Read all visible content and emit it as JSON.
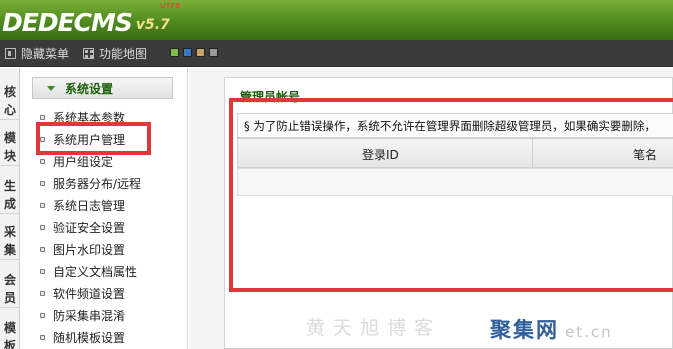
{
  "app": {
    "logo_text": "DEDECMS",
    "version": "v5.7",
    "version_badge": "UTF8"
  },
  "toolbar": {
    "hide_menu_label": "隐藏菜单",
    "function_map_label": "功能地图",
    "skin_colors": [
      "#7cc04a",
      "#3a78c2",
      "#c9a46a",
      "#9a9a9a"
    ]
  },
  "vertical_nav": [
    {
      "label": "核\n心"
    },
    {
      "label": "模\n块"
    },
    {
      "label": "生\n成"
    },
    {
      "label": "采\n集"
    },
    {
      "label": "会\n员"
    },
    {
      "label": "模\n板"
    }
  ],
  "sidebar": {
    "title": "系统设置",
    "items": [
      {
        "label": "系统基本参数"
      },
      {
        "label": "系统用户管理"
      },
      {
        "label": "用户组设定"
      },
      {
        "label": "服务器分布/远程"
      },
      {
        "label": "系统日志管理"
      },
      {
        "label": "验证安全设置"
      },
      {
        "label": "图片水印设置"
      },
      {
        "label": "自定义文档属性"
      },
      {
        "label": "软件频道设置"
      },
      {
        "label": "防采集串混淆"
      },
      {
        "label": "随机模板设置"
      }
    ]
  },
  "main": {
    "panel_title": "管理员帐号",
    "notice": "§ 为了防止错误操作，系统不允许在管理界面删除超级管理员，如果确实要删除，",
    "columns": [
      "登录ID",
      "笔名"
    ]
  },
  "watermark": {
    "text": "黄 天 旭 博 客",
    "brand": "聚集网",
    "suffix": "et.cn"
  },
  "colors": {
    "header_green": "#4f8a1e",
    "highlight_red": "#e0383a",
    "title_green": "#1d5e0c"
  }
}
